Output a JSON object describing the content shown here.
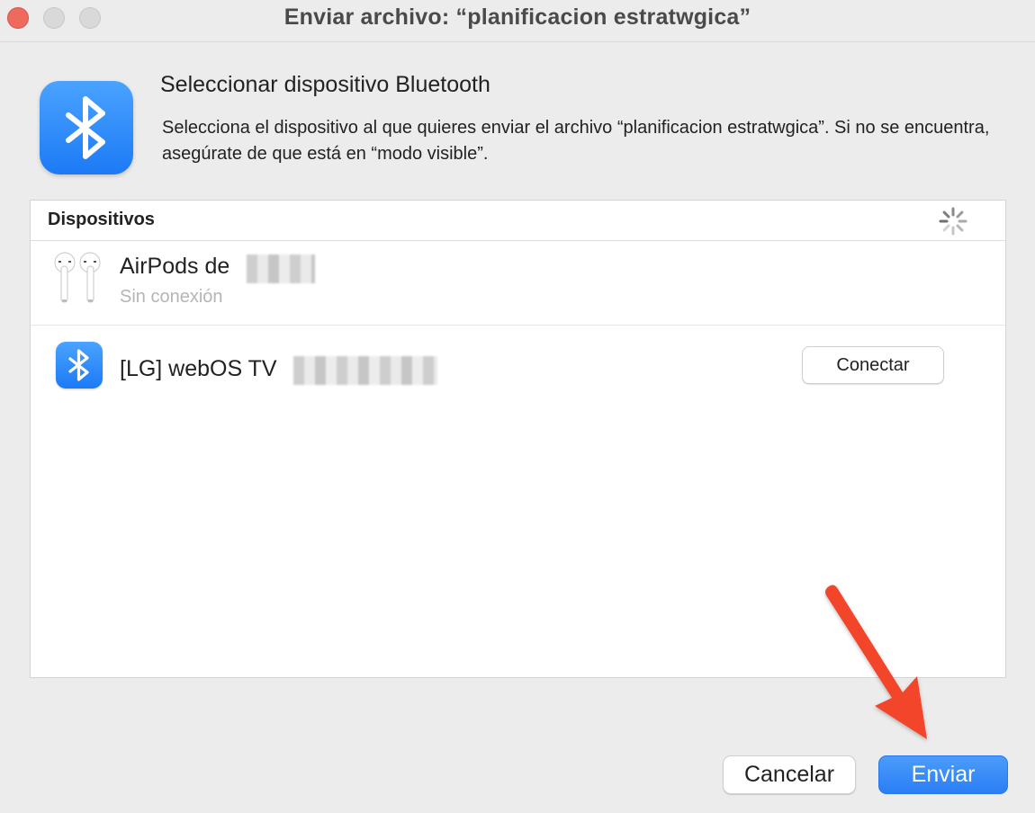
{
  "window": {
    "title": "Enviar archivo: “planificacion estratwgica”"
  },
  "header": {
    "icon": "bluetooth-icon",
    "heading": "Seleccionar dispositivo Bluetooth",
    "description": "Selecciona el dispositivo al que quieres enviar el archivo “planificacion estratwgica”. Si no se encuentra, asegúrate de que está en “modo visible”."
  },
  "devices": {
    "header_label": "Dispositivos",
    "loading_indicator": "spinner-icon",
    "items": [
      {
        "name": "AirPods de",
        "status": "Sin conexión",
        "icon": "airpods-icon"
      },
      {
        "name": "[LG] webOS TV",
        "icon": "bluetooth-icon",
        "action_label": "Conectar"
      }
    ]
  },
  "footer": {
    "cancel_label": "Cancelar",
    "send_label": "Enviar"
  },
  "colors": {
    "accent": "#2a7ef5",
    "annotation_arrow": "#f2452a"
  }
}
